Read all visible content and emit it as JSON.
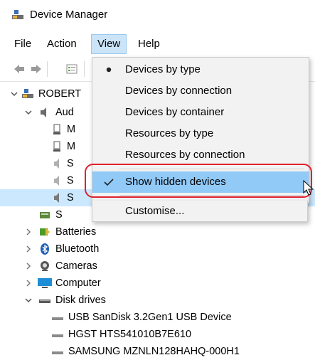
{
  "window": {
    "title": "Device Manager"
  },
  "menubar": {
    "items": [
      "File",
      "Action",
      "View",
      "Help"
    ]
  },
  "toolbar": {
    "buttons": [
      "back-icon",
      "forward-icon",
      "properties-icon"
    ]
  },
  "tree": {
    "root": "ROBERT",
    "audio": "Aud",
    "audio_children": [
      "M",
      "M",
      "S",
      "S",
      "S"
    ],
    "s_child": "S",
    "categories": [
      "Batteries",
      "Bluetooth",
      "Cameras",
      "Computer",
      "Disk drives"
    ],
    "disk_drives": [
      "USB  SanDisk 3.2Gen1 USB Device",
      "HGST HTS541010B7E610",
      "SAMSUNG MZNLN128HAHQ-000H1"
    ]
  },
  "view_menu": {
    "items": [
      "Devices by type",
      "Devices by connection",
      "Devices by container",
      "Resources by type",
      "Resources by connection",
      "Show hidden devices",
      "Customise..."
    ],
    "selected_radio": "Devices by type",
    "checked": "Show hidden devices"
  },
  "colors": {
    "menu_highlight": "#91c9f7",
    "annotation": "#e0202f",
    "active_menu": "#cce4f7"
  }
}
